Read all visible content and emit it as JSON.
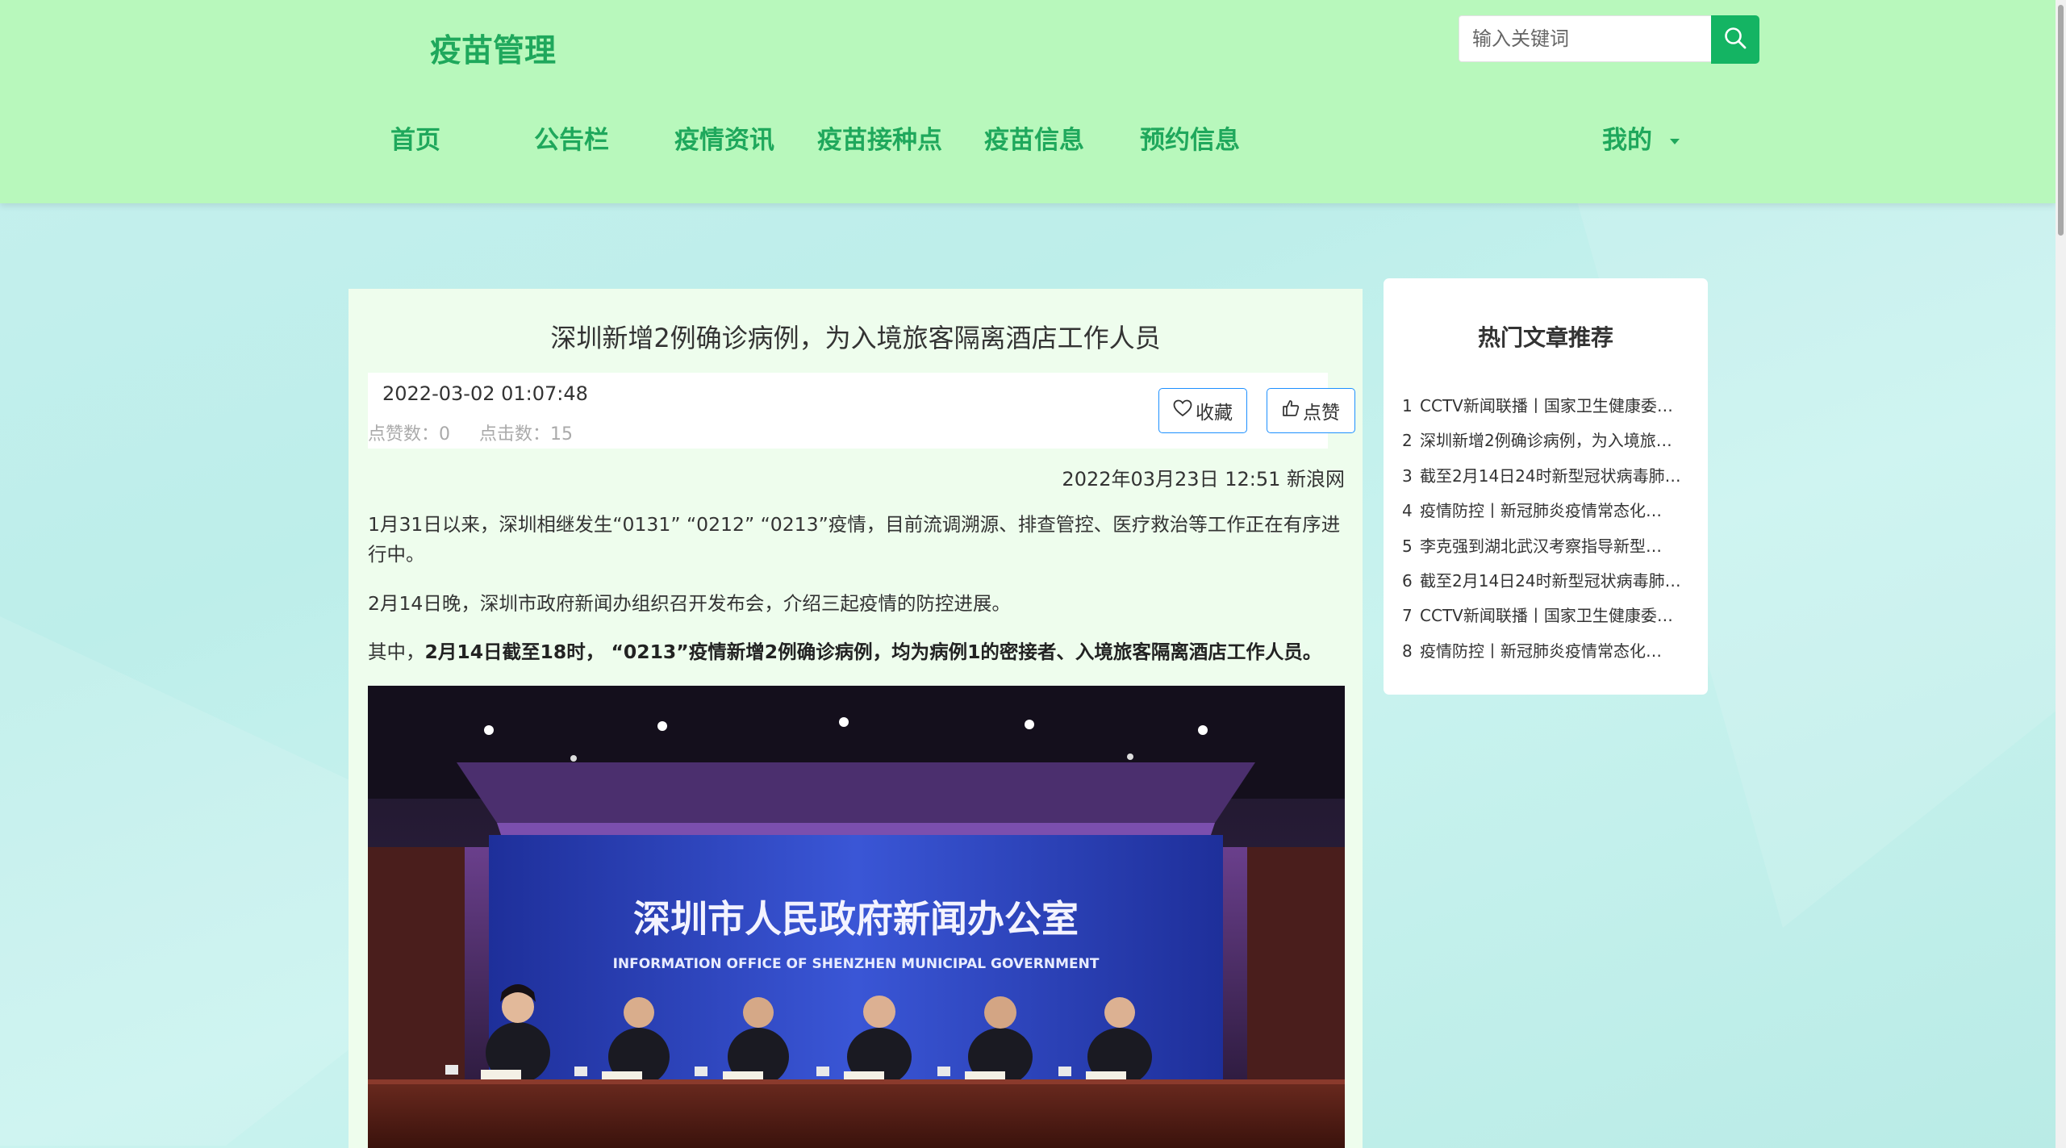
{
  "header": {
    "logo": "疫苗管理",
    "search_placeholder": "输入关键词",
    "nav": [
      "首页",
      "公告栏",
      "疫情资讯",
      "疫苗接种点",
      "疫苗信息",
      "预约信息"
    ],
    "user_menu": "我的"
  },
  "article": {
    "title": "深圳新增2例确诊病例，为入境旅客隔离酒店工作人员",
    "date": "2022-03-02 01:07:48",
    "likes_label": "点赞数：",
    "likes": "0",
    "clicks_label": "点击数：",
    "clicks": "15",
    "favorite_label": "收藏",
    "like_label": "点赞",
    "source": "2022年03月23日 12:51 新浪网",
    "para1": "1月31日以来，深圳相继发生“0131” “0212” “0213”疫情，目前流调溯源、排查管控、医疗救治等工作正在有序进行中。",
    "para2": "2月14日晚，深圳市政府新闻办组织召开发布会，介绍三起疫情的防控进展。",
    "para3_prefix": "其中，",
    "para3_bold": "2月14日截至18时， “0213”疫情新增2例确诊病例，均为病例1的密接者、入境旅客隔离酒店工作人员。",
    "photo": {
      "banner_cn": "深圳市人民政府新闻办公室",
      "banner_en": "INFORMATION OFFICE OF SHENZHEN MUNICIPAL GOVERNMENT"
    }
  },
  "hot": {
    "title": "热门文章推荐",
    "items": [
      {
        "num": "1",
        "text": "CCTV新闻联播丨国家卫生健康委…"
      },
      {
        "num": "2",
        "text": "深圳新增2例确诊病例，为入境旅…"
      },
      {
        "num": "3",
        "text": "截至2月14日24时新型冠状病毒肺…"
      },
      {
        "num": "4",
        "text": "疫情防控丨新冠肺炎疫情常态化…"
      },
      {
        "num": "5",
        "text": "李克强到湖北武汉考察指导新型…"
      },
      {
        "num": "6",
        "text": "截至2月14日24时新型冠状病毒肺…"
      },
      {
        "num": "7",
        "text": "CCTV新闻联播丨国家卫生健康委…"
      },
      {
        "num": "8",
        "text": "疫情防控丨新冠肺炎疫情常态化…"
      }
    ]
  },
  "colors": {
    "header_bg": "#b8f8bc",
    "accent_green": "#1fa85c",
    "search_button": "#14b463",
    "article_bg": "#eefded",
    "button_border": "#1e90ff"
  }
}
